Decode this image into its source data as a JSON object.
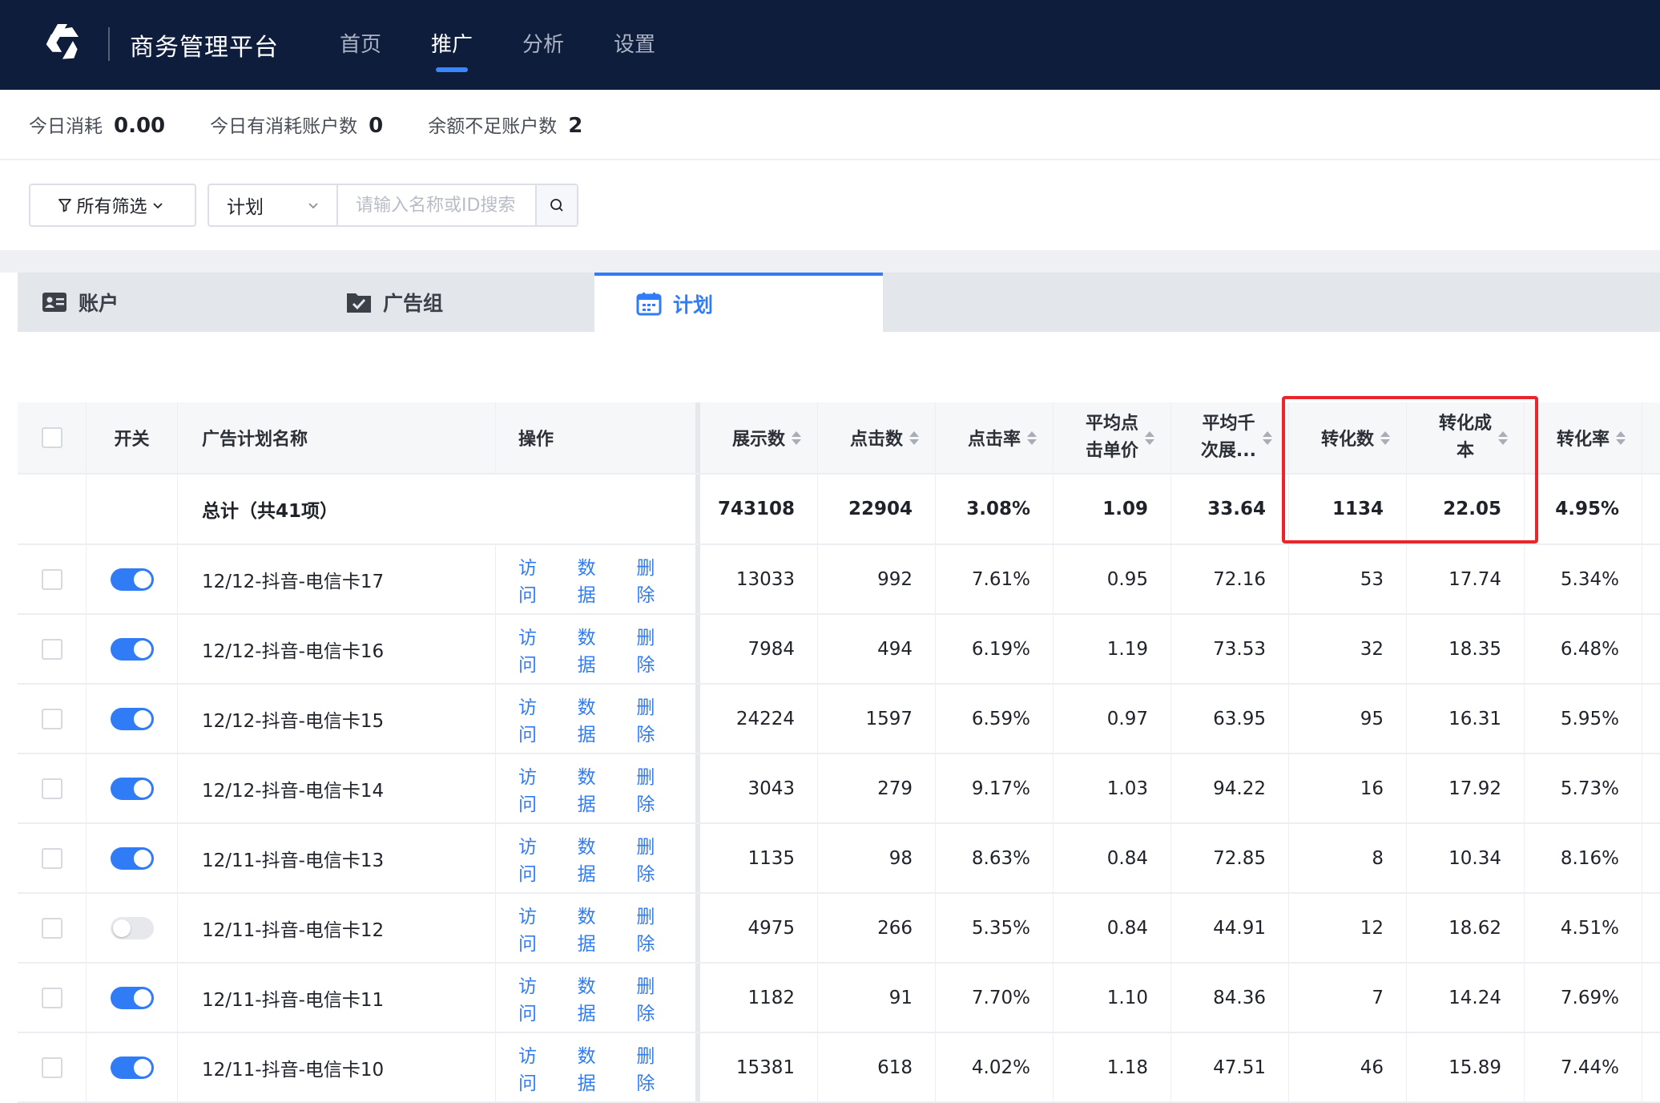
{
  "app": {
    "title": "商务管理平台",
    "logo_icon": "triangle-logo-icon"
  },
  "nav": {
    "items": [
      "首页",
      "推广",
      "分析",
      "设置"
    ],
    "active_index": 1
  },
  "stats": [
    {
      "label": "今日消耗",
      "value": "0.00"
    },
    {
      "label": "今日有消耗账户数",
      "value": "0"
    },
    {
      "label": "余额不足账户数",
      "value": "2"
    }
  ],
  "filter": {
    "all_filters_label": "所有筛选",
    "scope_value": "计划",
    "search_placeholder": "请输入名称或ID搜索"
  },
  "tabs": [
    {
      "label": "账户",
      "icon": "id-card-icon"
    },
    {
      "label": "广告组",
      "icon": "folder-check-icon"
    },
    {
      "label": "计划",
      "icon": "calendar-icon"
    }
  ],
  "active_tab": 2,
  "table": {
    "headers": {
      "switch": "开关",
      "name": "广告计划名称",
      "ops": "操作",
      "impressions": "展示数",
      "clicks": "点击数",
      "ctr": "点击率",
      "cpc_line1": "平均点",
      "cpc_line2": "击单价",
      "cpm_line1": "平均千",
      "cpm_line2": "次展...",
      "conversions": "转化数",
      "cpa_line1": "转化成",
      "cpa_line2": "本",
      "cvr": "转化率"
    },
    "total": {
      "label": "总计（共41项）",
      "impressions": "743108",
      "clicks": "22904",
      "ctr": "3.08%",
      "cpc": "1.09",
      "cpm": "33.64",
      "conversions": "1134",
      "cpa": "22.05",
      "cvr": "4.95%"
    },
    "op_labels": [
      "访问",
      "数据",
      "删除"
    ],
    "rows": [
      {
        "enabled": true,
        "name": "12/12-抖音-电信卡17",
        "impressions": "13033",
        "clicks": "992",
        "ctr": "7.61%",
        "cpc": "0.95",
        "cpm": "72.16",
        "conversions": "53",
        "cpa": "17.74",
        "cvr": "5.34%"
      },
      {
        "enabled": true,
        "name": "12/12-抖音-电信卡16",
        "impressions": "7984",
        "clicks": "494",
        "ctr": "6.19%",
        "cpc": "1.19",
        "cpm": "73.53",
        "conversions": "32",
        "cpa": "18.35",
        "cvr": "6.48%"
      },
      {
        "enabled": true,
        "name": "12/12-抖音-电信卡15",
        "impressions": "24224",
        "clicks": "1597",
        "ctr": "6.59%",
        "cpc": "0.97",
        "cpm": "63.95",
        "conversions": "95",
        "cpa": "16.31",
        "cvr": "5.95%"
      },
      {
        "enabled": true,
        "name": "12/12-抖音-电信卡14",
        "impressions": "3043",
        "clicks": "279",
        "ctr": "9.17%",
        "cpc": "1.03",
        "cpm": "94.22",
        "conversions": "16",
        "cpa": "17.92",
        "cvr": "5.73%"
      },
      {
        "enabled": true,
        "name": "12/11-抖音-电信卡13",
        "impressions": "1135",
        "clicks": "98",
        "ctr": "8.63%",
        "cpc": "0.84",
        "cpm": "72.85",
        "conversions": "8",
        "cpa": "10.34",
        "cvr": "8.16%"
      },
      {
        "enabled": false,
        "name": "12/11-抖音-电信卡12",
        "impressions": "4975",
        "clicks": "266",
        "ctr": "5.35%",
        "cpc": "0.84",
        "cpm": "44.91",
        "conversions": "12",
        "cpa": "18.62",
        "cvr": "4.51%"
      },
      {
        "enabled": true,
        "name": "12/11-抖音-电信卡11",
        "impressions": "1182",
        "clicks": "91",
        "ctr": "7.70%",
        "cpc": "1.10",
        "cpm": "84.36",
        "conversions": "7",
        "cpa": "14.24",
        "cvr": "7.69%"
      },
      {
        "enabled": true,
        "name": "12/11-抖音-电信卡10",
        "impressions": "15381",
        "clicks": "618",
        "ctr": "4.02%",
        "cpc": "1.18",
        "cpm": "47.51",
        "conversions": "46",
        "cpa": "15.89",
        "cvr": "7.44%"
      }
    ]
  },
  "colors": {
    "nav_bg": "#0f1d3c",
    "accent": "#2f7cf6",
    "highlight": "#e8262b"
  }
}
